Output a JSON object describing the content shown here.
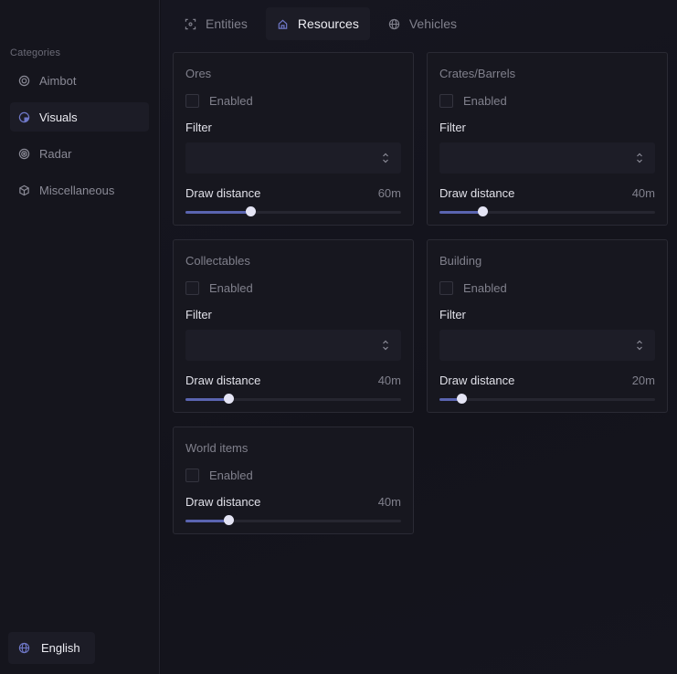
{
  "sidebar": {
    "title": "Categories",
    "items": [
      {
        "label": "Aimbot",
        "icon": "target-icon",
        "active": false
      },
      {
        "label": "Visuals",
        "icon": "eye-icon",
        "active": true
      },
      {
        "label": "Radar",
        "icon": "radar-icon",
        "active": false
      },
      {
        "label": "Miscellaneous",
        "icon": "cube-icon",
        "active": false
      }
    ],
    "language": "English"
  },
  "tabs": [
    {
      "label": "Entities",
      "icon": "scan-icon"
    },
    {
      "label": "Resources",
      "icon": "home-icon"
    },
    {
      "label": "Vehicles",
      "icon": "globe-icon"
    }
  ],
  "active_tab": "Resources",
  "common": {
    "enabled_label": "Enabled",
    "filter_label": "Filter",
    "draw_distance_label": "Draw distance"
  },
  "cards": {
    "ores": {
      "title": "Ores",
      "value": "60m",
      "percent": 30
    },
    "crates": {
      "title": "Crates/Barrels",
      "value": "40m",
      "percent": 20
    },
    "collectables": {
      "title": "Collectables",
      "value": "40m",
      "percent": 20
    },
    "building": {
      "title": "Building",
      "value": "20m",
      "percent": 10
    },
    "world": {
      "title": "World items",
      "value": "40m",
      "percent": 20
    }
  },
  "colors": {
    "accent": "#5a64b0",
    "thumb": "#e4e4f4",
    "background": "#12121a"
  }
}
